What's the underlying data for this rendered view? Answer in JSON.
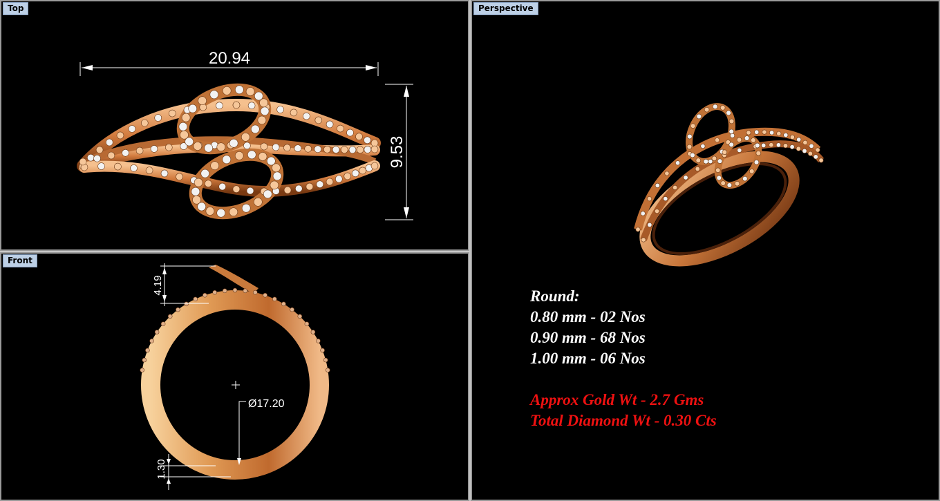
{
  "viewports": {
    "top": {
      "label": "Top",
      "width_dim": "20.94",
      "height_dim": "9.53"
    },
    "front": {
      "label": "Front",
      "top_dim": "4.19",
      "diameter_dim": "Ø17.20",
      "bottom_dim": "1.30"
    },
    "perspective": {
      "label": "Perspective",
      "specs": {
        "heading": "Round:",
        "lines": [
          "0.80 mm - 02 Nos",
          "0.90 mm - 68 Nos",
          "1.00 mm - 06 Nos"
        ],
        "gold": "Approx Gold Wt - 2.7 Gms",
        "diamond": "Total Diamond Wt - 0.30 Cts"
      }
    }
  },
  "colors": {
    "gold": "#d98a52",
    "gold_dark": "#8a4418",
    "gold_light": "#f6c79a",
    "diamond": "#f2f2f2",
    "spec_red": "#ee1111",
    "label_bg": "#bdd0e6"
  }
}
